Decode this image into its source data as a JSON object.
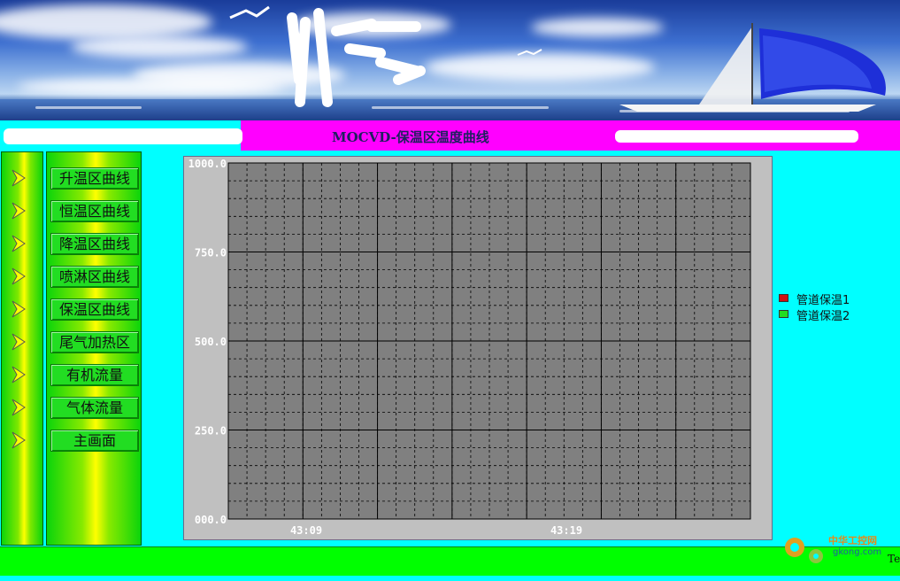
{
  "page": {
    "title": "MOCVD-保温区温度曲线"
  },
  "nav": {
    "items": [
      {
        "label": "升温区曲线"
      },
      {
        "label": "恒温区曲线"
      },
      {
        "label": "降温区曲线"
      },
      {
        "label": "喷淋区曲线"
      },
      {
        "label": "保温区曲线"
      },
      {
        "label": "尾气加热区"
      },
      {
        "label": "有机流量"
      },
      {
        "label": "气体流量"
      },
      {
        "label": "主画面"
      }
    ]
  },
  "chart_data": {
    "type": "line",
    "title": "",
    "xlabel": "",
    "ylabel": "",
    "ylim": [
      0,
      1000
    ],
    "y_ticks": [
      "1000.0",
      "750.0",
      "500.0",
      "250.0",
      "000.0"
    ],
    "x_ticks": [
      "43:09",
      "43:19"
    ],
    "grid": true,
    "background": "#808080",
    "legend_position": "right",
    "series": [
      {
        "name": "管道保温1",
        "color": "#d01010",
        "values": []
      },
      {
        "name": "管道保温2",
        "color": "#22dd22",
        "values": []
      }
    ]
  },
  "status": {
    "text": "Te"
  },
  "watermark": {
    "name": "中华工控网",
    "url": "gkong.com"
  },
  "colors": {
    "accent_cyan": "#00ffff",
    "title_bar": "#ff00ff",
    "status_bar": "#00ff00",
    "nav_button": "#22dd22"
  },
  "icons": {
    "nav_arrow": "chevron-right-icon"
  }
}
